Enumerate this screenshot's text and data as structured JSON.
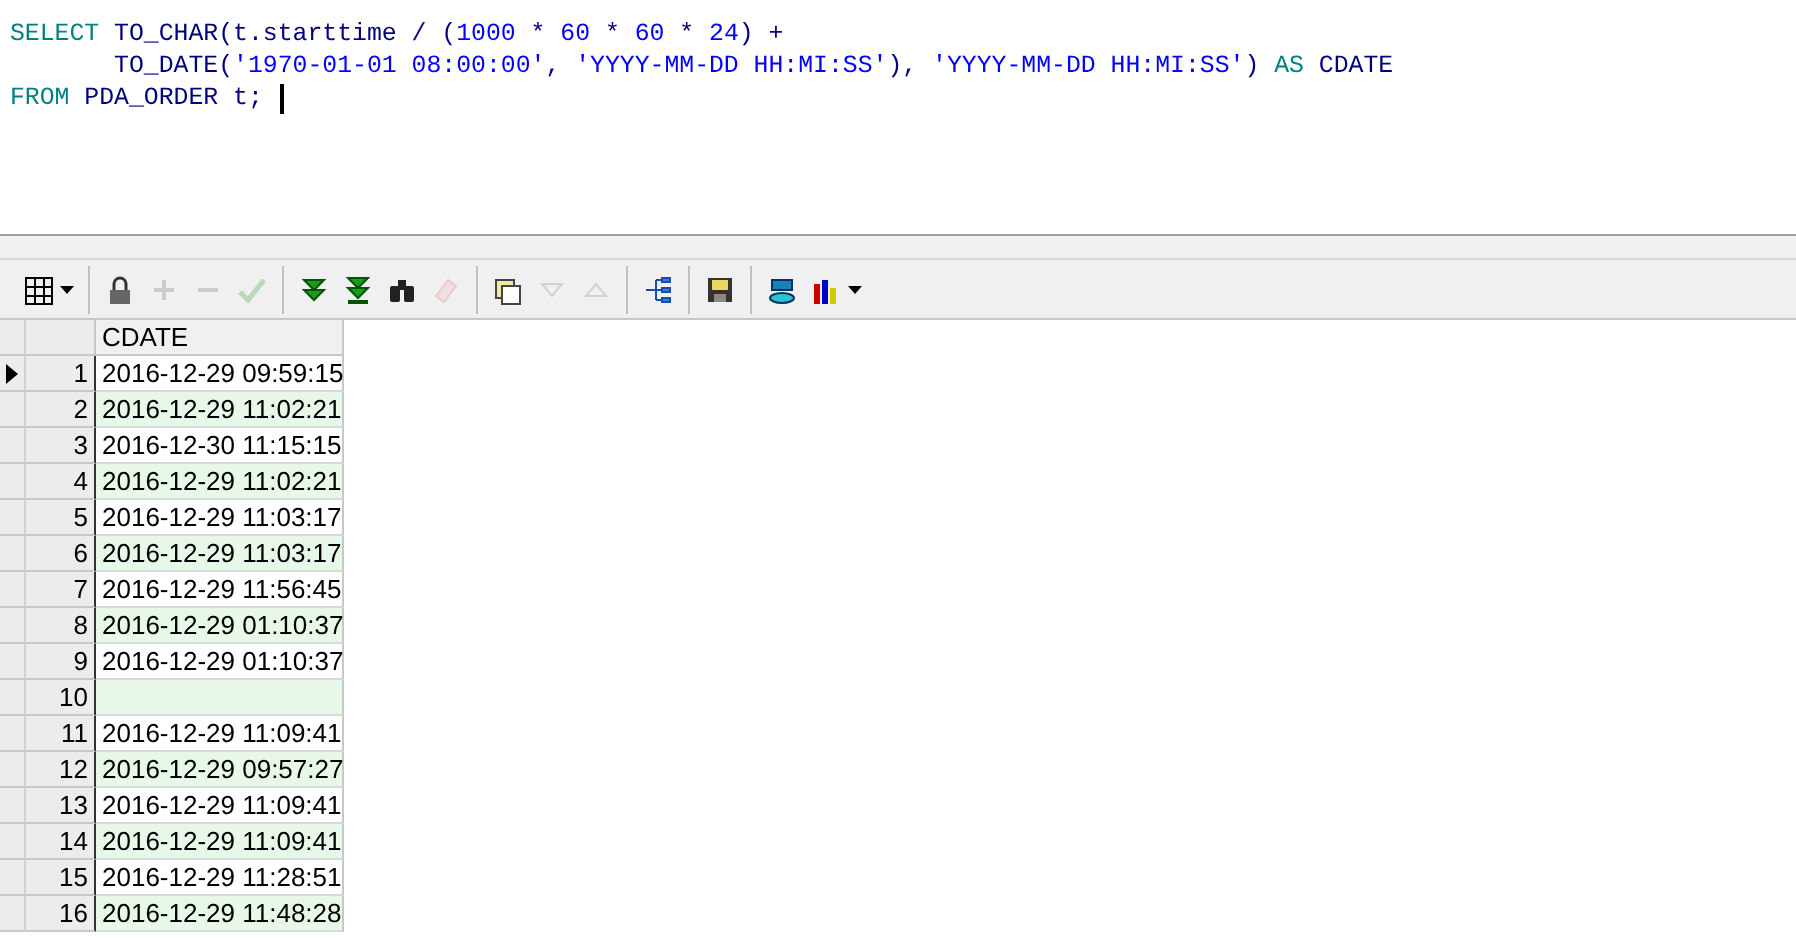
{
  "editor": {
    "lines": [
      [
        {
          "kind": "keyword",
          "text": "SELECT"
        },
        {
          "kind": "plain",
          "text": " TO_CHAR(t.starttime / ("
        },
        {
          "kind": "number",
          "text": "1000"
        },
        {
          "kind": "plain",
          "text": " * "
        },
        {
          "kind": "number",
          "text": "60"
        },
        {
          "kind": "plain",
          "text": " * "
        },
        {
          "kind": "number",
          "text": "60"
        },
        {
          "kind": "plain",
          "text": " * "
        },
        {
          "kind": "number",
          "text": "24"
        },
        {
          "kind": "plain",
          "text": ") +"
        }
      ],
      [
        {
          "kind": "plain",
          "text": "       TO_DATE("
        },
        {
          "kind": "string",
          "text": "'1970-01-01 08:00:00'"
        },
        {
          "kind": "plain",
          "text": ", "
        },
        {
          "kind": "string",
          "text": "'YYYY-MM-DD HH:MI:SS'"
        },
        {
          "kind": "plain",
          "text": "), "
        },
        {
          "kind": "string",
          "text": "'YYYY-MM-DD HH:MI:SS'"
        },
        {
          "kind": "plain",
          "text": ") "
        },
        {
          "kind": "keyword",
          "text": "AS"
        },
        {
          "kind": "plain",
          "text": " CDATE"
        }
      ],
      [
        {
          "kind": "keyword",
          "text": "FROM"
        },
        {
          "kind": "plain",
          "text": " PDA_ORDER t;"
        }
      ]
    ]
  },
  "toolbar": [
    {
      "kind": "grid",
      "disabled": false,
      "dropdown": true
    },
    {
      "kind": "sep"
    },
    {
      "kind": "lock",
      "disabled": false
    },
    {
      "kind": "plus",
      "disabled": true
    },
    {
      "kind": "minus",
      "disabled": true
    },
    {
      "kind": "check",
      "disabled": true
    },
    {
      "kind": "sep"
    },
    {
      "kind": "next",
      "disabled": false
    },
    {
      "kind": "last",
      "disabled": false
    },
    {
      "kind": "find",
      "disabled": false
    },
    {
      "kind": "clear",
      "disabled": true
    },
    {
      "kind": "sep"
    },
    {
      "kind": "query",
      "disabled": false
    },
    {
      "kind": "down",
      "disabled": true
    },
    {
      "kind": "up",
      "disabled": true
    },
    {
      "kind": "sep"
    },
    {
      "kind": "tree",
      "disabled": false
    },
    {
      "kind": "sep"
    },
    {
      "kind": "save",
      "disabled": false
    },
    {
      "kind": "sep"
    },
    {
      "kind": "db",
      "disabled": false
    },
    {
      "kind": "chart",
      "disabled": false,
      "dropdown": true
    }
  ],
  "grid": {
    "columns": [
      "CDATE"
    ],
    "rows": [
      {
        "number": "1",
        "selected": true,
        "cells": [
          "2016-12-29 09:59:15"
        ]
      },
      {
        "number": "2",
        "selected": false,
        "cells": [
          "2016-12-29 11:02:21"
        ]
      },
      {
        "number": "3",
        "selected": false,
        "cells": [
          "2016-12-30 11:15:15"
        ]
      },
      {
        "number": "4",
        "selected": false,
        "cells": [
          "2016-12-29 11:02:21"
        ]
      },
      {
        "number": "5",
        "selected": false,
        "cells": [
          "2016-12-29 11:03:17"
        ]
      },
      {
        "number": "6",
        "selected": false,
        "cells": [
          "2016-12-29 11:03:17"
        ]
      },
      {
        "number": "7",
        "selected": false,
        "cells": [
          "2016-12-29 11:56:45"
        ]
      },
      {
        "number": "8",
        "selected": false,
        "cells": [
          "2016-12-29 01:10:37"
        ]
      },
      {
        "number": "9",
        "selected": false,
        "cells": [
          "2016-12-29 01:10:37"
        ]
      },
      {
        "number": "10",
        "selected": false,
        "cells": [
          null
        ]
      },
      {
        "number": "11",
        "selected": false,
        "cells": [
          "2016-12-29 11:09:41"
        ]
      },
      {
        "number": "12",
        "selected": false,
        "cells": [
          "2016-12-29 09:57:27"
        ]
      },
      {
        "number": "13",
        "selected": false,
        "cells": [
          "2016-12-29 11:09:41"
        ]
      },
      {
        "number": "14",
        "selected": false,
        "cells": [
          "2016-12-29 11:09:41"
        ]
      },
      {
        "number": "15",
        "selected": false,
        "cells": [
          "2016-12-29 11:28:51"
        ]
      },
      {
        "number": "16",
        "selected": false,
        "cells": [
          "2016-12-29 11:48:28"
        ]
      }
    ]
  }
}
